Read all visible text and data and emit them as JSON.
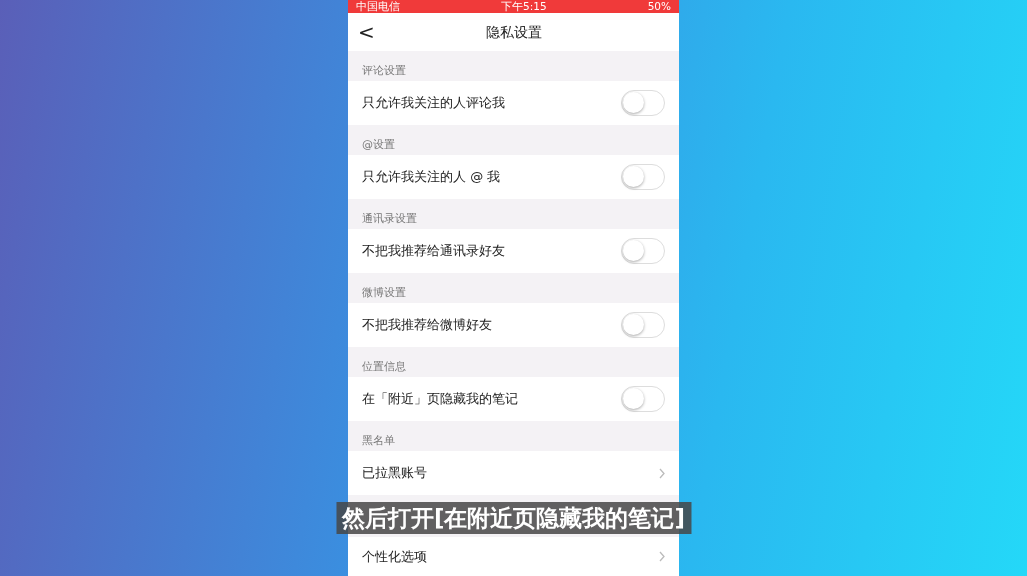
{
  "status_bar": {
    "carrier": "中国电信",
    "time": "下午5:15",
    "battery": "50%"
  },
  "nav": {
    "back": "<",
    "title": "隐私设置"
  },
  "sections": [
    {
      "header": "评论设置",
      "rows": [
        {
          "kind": "toggle",
          "label": "只允许我关注的人评论我",
          "on": false
        }
      ]
    },
    {
      "header": "@设置",
      "rows": [
        {
          "kind": "toggle",
          "label": "只允许我关注的人 @ 我",
          "on": false
        }
      ]
    },
    {
      "header": "通讯录设置",
      "rows": [
        {
          "kind": "toggle",
          "label": "不把我推荐给通讯录好友",
          "on": false
        }
      ]
    },
    {
      "header": "微博设置",
      "rows": [
        {
          "kind": "toggle",
          "label": "不把我推荐给微博好友",
          "on": false
        }
      ]
    },
    {
      "header": "位置信息",
      "rows": [
        {
          "kind": "toggle",
          "label": "在「附近」页隐藏我的笔记",
          "on": false
        }
      ]
    },
    {
      "header": "黑名单",
      "rows": [
        {
          "kind": "link",
          "label": "已拉黑账号"
        }
      ]
    },
    {
      "rows": [
        {
          "kind": "link",
          "label": "个性化选项"
        }
      ]
    }
  ],
  "caption": "然后打开[在附近页隐藏我的笔记]"
}
